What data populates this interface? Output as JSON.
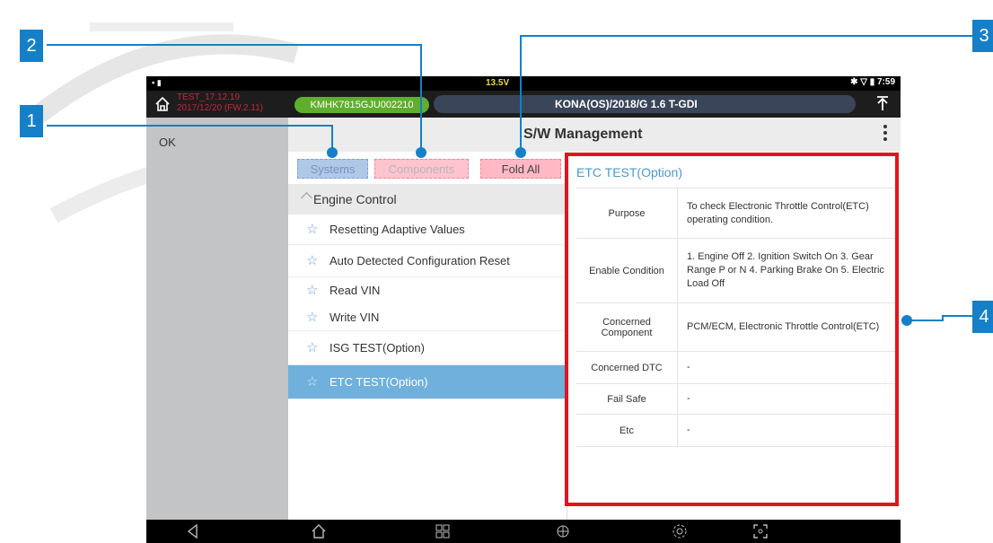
{
  "status_bar": {
    "voltage": "13.5V",
    "time": "7:59"
  },
  "title_bar": {
    "test_line1": "TEST_17.12.19",
    "test_line2": "2017/12/20 (FW.2.11)",
    "vin": "KMHK7815GJU002210",
    "vehicle": "KONA(OS)/2018/G 1.6 T-GDI"
  },
  "left_panel": {
    "ok_label": "OK"
  },
  "header": {
    "title": "S/W Management"
  },
  "tabs": {
    "systems": "Systems",
    "components": "Components",
    "fold_all": "Fold All"
  },
  "list": {
    "group": "Engine Control",
    "items": [
      {
        "label": "Resetting Adaptive Values"
      },
      {
        "label": "Auto Detected Configuration Reset"
      },
      {
        "label": "Read VIN"
      },
      {
        "label": "Write VIN"
      },
      {
        "label": "ISG TEST(Option)"
      },
      {
        "label": "ETC TEST(Option)",
        "selected": true
      }
    ]
  },
  "detail": {
    "title": "ETC TEST(Option)",
    "rows": [
      {
        "key": "Purpose",
        "value": "To check Electronic Throttle Control(ETC) operating condition."
      },
      {
        "key": "Enable Condition",
        "value": "1. Engine Off 2. Ignition Switch On 3. Gear Range P or N 4. Parking Brake On 5. Electric Load Off"
      },
      {
        "key": "Concerned Component",
        "value": "PCM/ECM, Electronic Throttle Control(ETC)"
      },
      {
        "key": "Concerned DTC",
        "value": "-"
      },
      {
        "key": "Fail Safe",
        "value": "-"
      },
      {
        "key": "Etc",
        "value": "-"
      }
    ]
  },
  "callouts": {
    "c1": "1",
    "c2": "2",
    "c3": "3",
    "c4": "4"
  },
  "colors": {
    "accent": "#1580c7",
    "highlight": "#e3141b",
    "selected_row": "#6fb0dc",
    "vin_pill": "#5fae2d"
  },
  "icons": [
    "home-icon",
    "upload-icon",
    "menu-icon",
    "star-icon",
    "back-icon",
    "apps-icon",
    "globe-icon",
    "gear-icon",
    "screenshot-icon"
  ]
}
